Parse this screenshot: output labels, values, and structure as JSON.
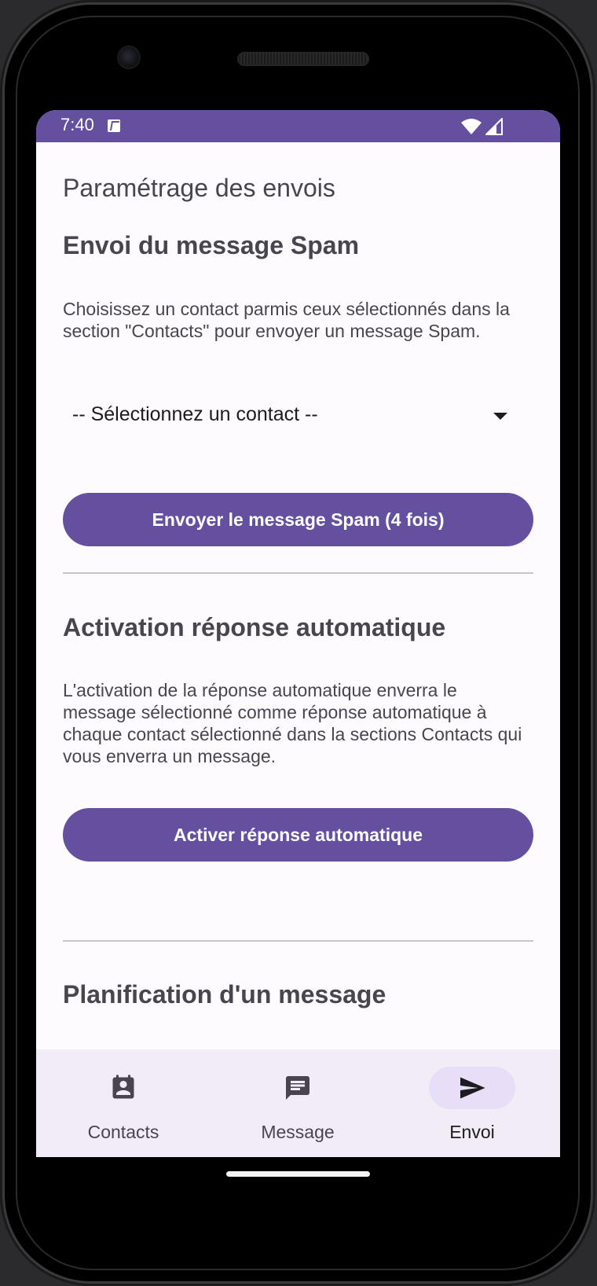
{
  "status_bar": {
    "time": "7:40",
    "background": "#6550a0",
    "icons": [
      "android-notification-icon",
      "wifi-icon",
      "signal-icon"
    ]
  },
  "page": {
    "title": "Paramétrage des envois"
  },
  "spam_section": {
    "heading": "Envoi du message Spam",
    "description": "Choisissez un contact parmis ceux sélectionnés dans la section \"Contacts\" pour envoyer un message Spam.",
    "contact_select_value": "-- Sélectionnez un contact --",
    "send_button_label": "Envoyer le message Spam (4 fois)"
  },
  "auto_reply_section": {
    "heading": "Activation réponse automatique",
    "description": "L'activation de la réponse automatique enverra le message sélectionné comme réponse automatique à chaque contact sélectionné dans la sections Contacts qui vous enverra un message.",
    "activate_button_label": "Activer réponse automatique"
  },
  "schedule_section": {
    "heading": "Planification d'un message"
  },
  "bottom_nav": {
    "items": [
      {
        "label": "Contacts",
        "icon": "contact-card-icon",
        "active": false
      },
      {
        "label": "Message",
        "icon": "message-bubble-icon",
        "active": false
      },
      {
        "label": "Envoi",
        "icon": "send-icon",
        "active": true
      }
    ]
  },
  "colors": {
    "primary": "#6550a0",
    "surface": "#fefbff",
    "nav_background": "#f2ecf6",
    "nav_active_indicator": "#e8def8",
    "text": "#49454f"
  }
}
